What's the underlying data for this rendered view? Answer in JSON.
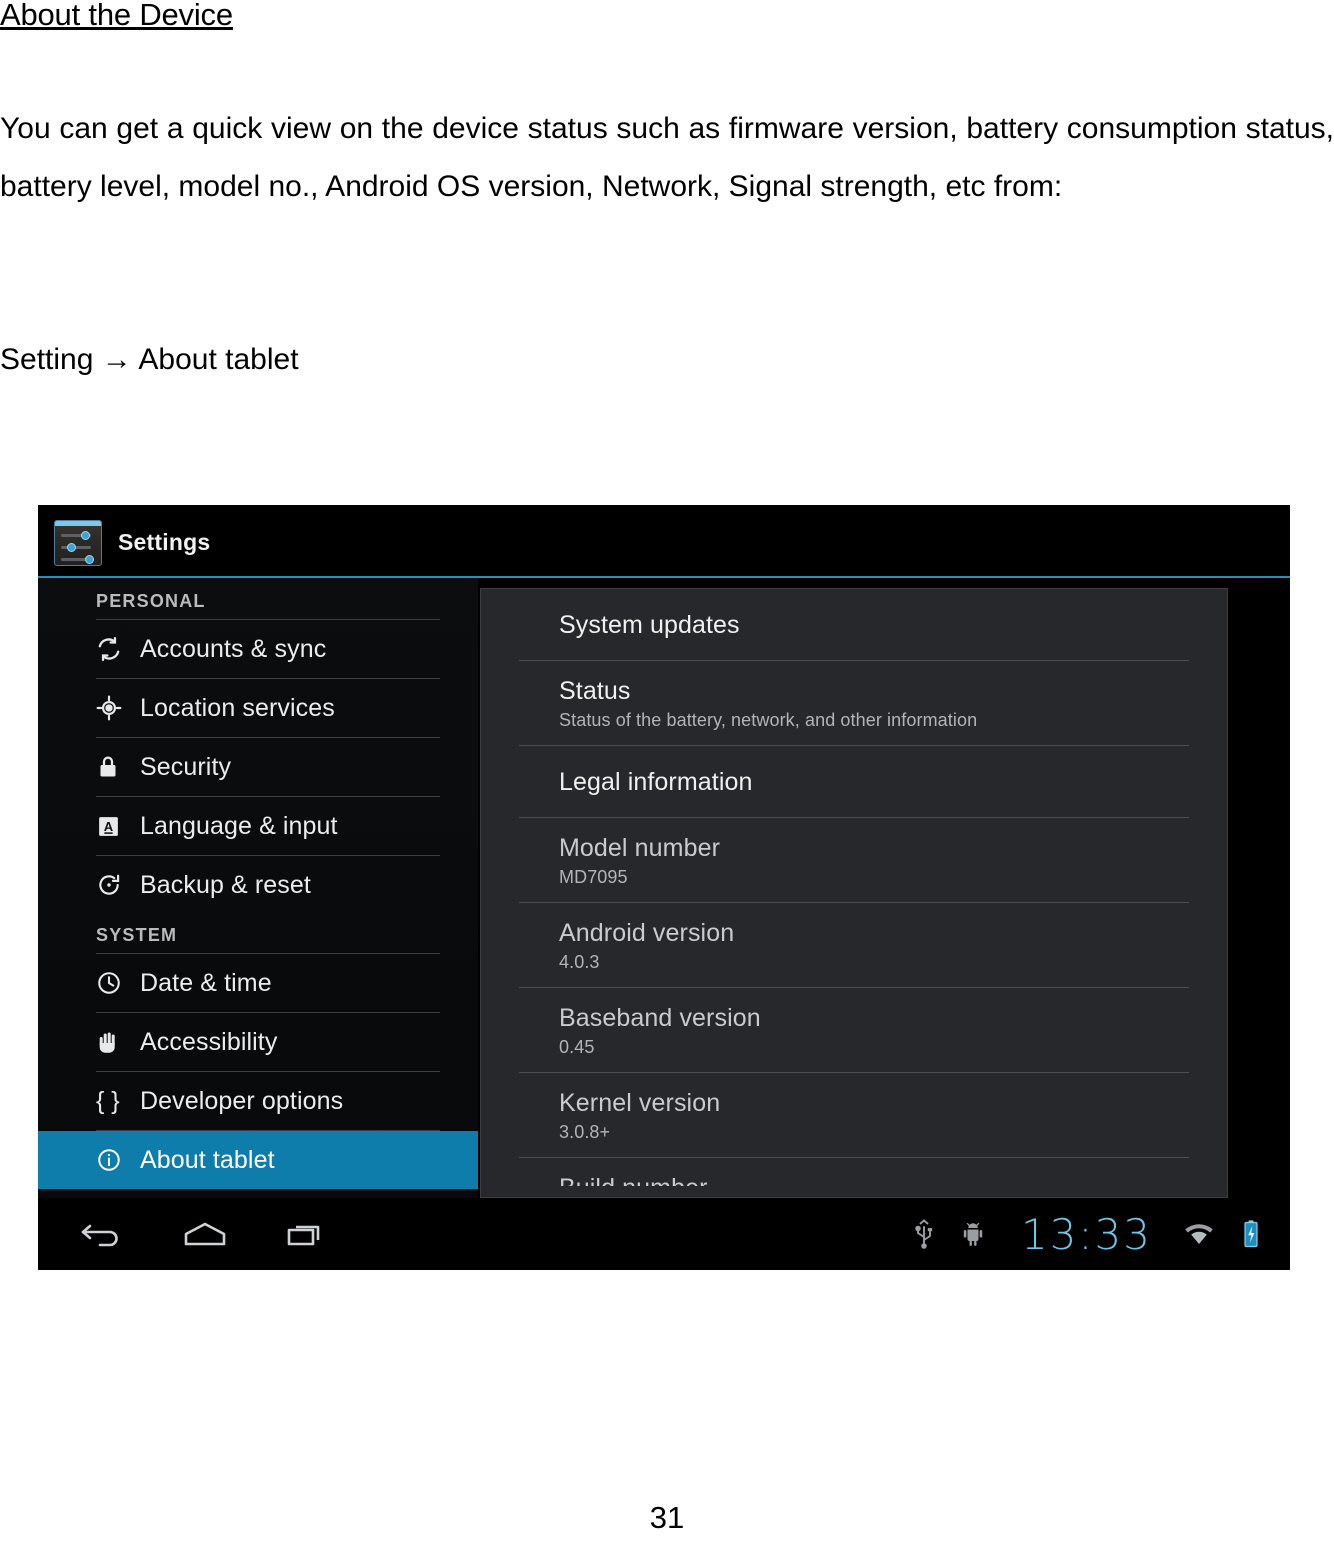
{
  "document": {
    "heading": "About the Device",
    "paragraph": "You can get a quick view on the device status such as firmware version, battery consumption status, battery level, model no., Android OS version, Network, Signal strength, etc from:",
    "navigation_line": "Setting → About tablet",
    "page_number": "31"
  },
  "tablet": {
    "actionbar": {
      "app_title": "Settings",
      "icon": "settings-sliders-icon"
    },
    "sidebar": {
      "sections": [
        {
          "header": "PERSONAL",
          "items": [
            {
              "label": "Accounts & sync",
              "icon": "sync-icon",
              "selected": false
            },
            {
              "label": "Location services",
              "icon": "location-crosshair-icon",
              "selected": false
            },
            {
              "label": "Security",
              "icon": "lock-icon",
              "selected": false
            },
            {
              "label": "Language & input",
              "icon": "language-a-icon",
              "selected": false
            },
            {
              "label": "Backup & reset",
              "icon": "backup-restore-icon",
              "selected": false
            }
          ]
        },
        {
          "header": "SYSTEM",
          "items": [
            {
              "label": "Date & time",
              "icon": "clock-icon",
              "selected": false
            },
            {
              "label": "Accessibility",
              "icon": "hand-icon",
              "selected": false
            },
            {
              "label": "Developer options",
              "icon": "braces-icon",
              "selected": false
            },
            {
              "label": "About tablet",
              "icon": "info-circle-icon",
              "selected": true
            }
          ]
        }
      ],
      "selected_highlight_color": "#0f7dac"
    },
    "detail": {
      "rows": [
        {
          "title": "System updates",
          "sub": ""
        },
        {
          "title": "Status",
          "sub": "Status of the battery, network, and other information"
        },
        {
          "title": "Legal information",
          "sub": ""
        },
        {
          "title": "Model number",
          "sub": "MD7095"
        },
        {
          "title": "Android version",
          "sub": "4.0.3"
        },
        {
          "title": "Baseband version",
          "sub": "0.45"
        },
        {
          "title": "Kernel version",
          "sub": "3.0.8+"
        },
        {
          "title": "Build number",
          "sub": ""
        }
      ]
    },
    "navbar": {
      "back": "back-icon",
      "home": "home-icon",
      "recents": "recent-apps-icon",
      "status": {
        "usb": "usb-icon",
        "debug": "android-debug-icon",
        "clock": "13:33",
        "wifi": "wifi-icon",
        "battery": "battery-charging-icon"
      },
      "clock_color": "#6fc7e6"
    }
  }
}
